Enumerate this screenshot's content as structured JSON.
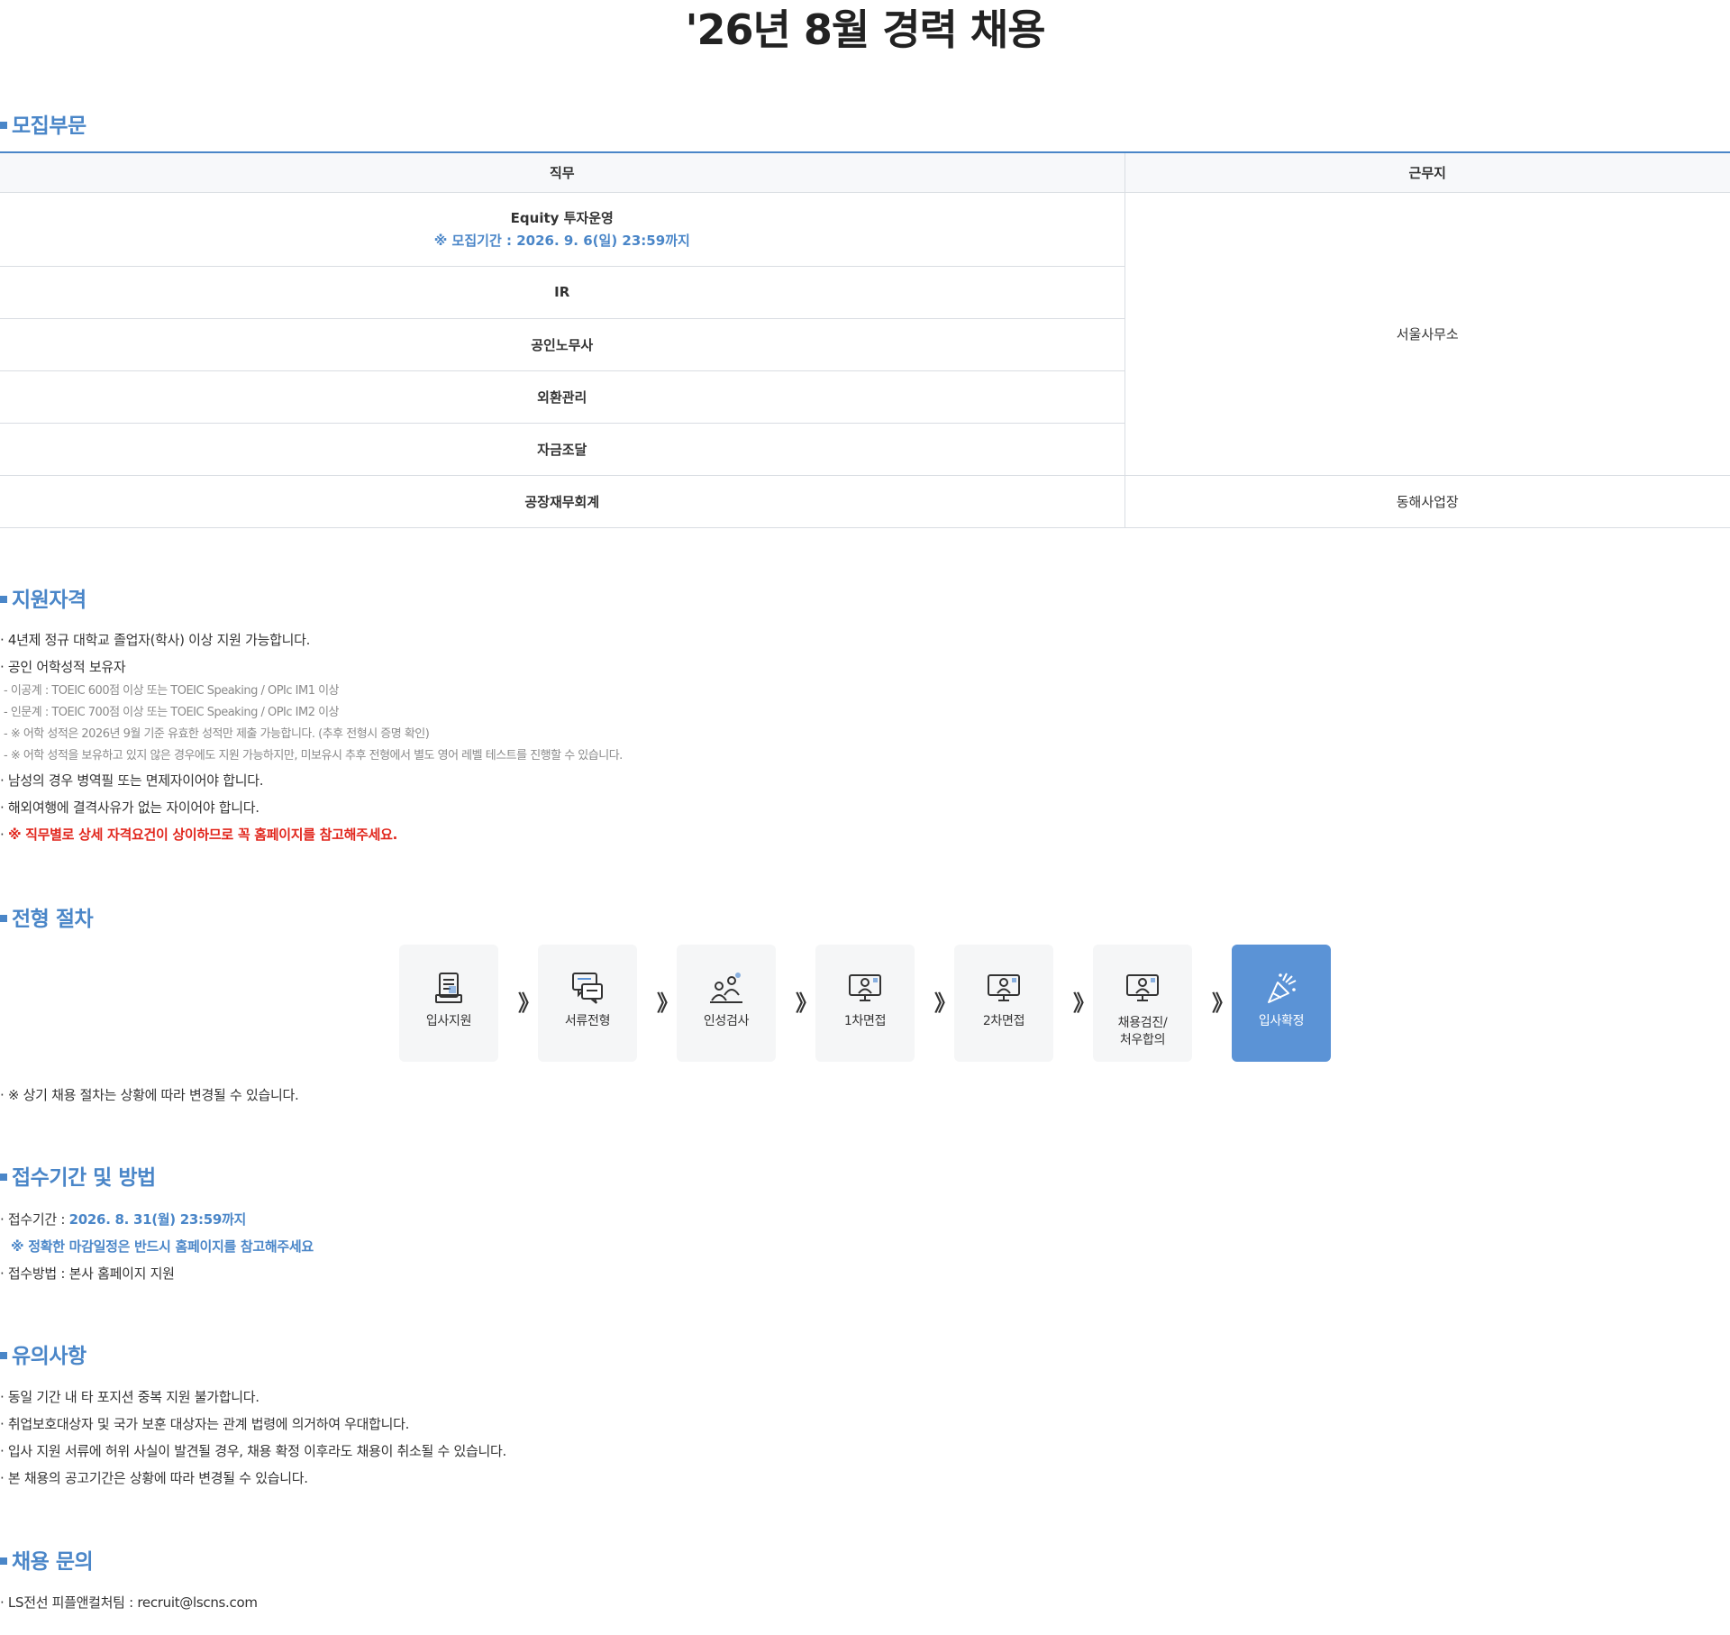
{
  "page": {
    "title": "'26년 8월 경력 채용"
  },
  "sections": {
    "recruit": "모집부문",
    "qualification": "지원자격",
    "process": "전형 절차",
    "application": "접수기간 및 방법",
    "notice": "유의사항",
    "inquiry": "채용 문의"
  },
  "table": {
    "headers": {
      "job": "직무",
      "location": "근무지"
    },
    "rows": [
      {
        "job": "Equity 투자운영",
        "note": "※ 모집기간 : 2026. 9. 6(일) 23:59까지"
      },
      {
        "job": "IR"
      },
      {
        "job": "공인노무사"
      },
      {
        "job": "외환관리"
      },
      {
        "job": "자금조달"
      },
      {
        "job": "공장재무회계"
      }
    ],
    "locations": {
      "seoul": "서울사무소",
      "donghae": "동해사업장"
    }
  },
  "qualification": {
    "items": [
      "· 4년제 정규 대학교 졸업자(학사) 이상 지원 가능합니다.",
      "· 공인 어학성적 보유자"
    ],
    "sub_items": [
      "- 이공계 : TOEIC 600점 이상 또는 TOEIC Speaking / OPIc IM1 이상",
      "- 인문계 : TOEIC 700점 이상 또는 TOEIC Speaking / OPIc IM2 이상",
      "- ※ 어학 성적은 2026년 9월 기준 유효한 성적만 제출 가능합니다. (추후 전형시 증명 확인)",
      "- ※ 어학 성적을 보유하고 있지 않은 경우에도 지원 가능하지만, 미보유시 추후 전형에서 별도 영어 레벨 테스트를 진행할 수 있습니다."
    ],
    "items2": [
      "· 남성의 경우 병역필 또는 면제자이어야 합니다.",
      "· 해외여행에 결격사유가 없는 자이어야 합니다."
    ],
    "warn_prefix": "· ",
    "warning": "※ 직무별로 상세 자격요건이 상이하므로 꼭 홈페이지를 참고해주세요."
  },
  "process": {
    "steps": [
      {
        "label": "입사지원",
        "icon": "document-icon"
      },
      {
        "label": "서류전형",
        "icon": "chat-icon"
      },
      {
        "label": "인성검사",
        "icon": "people-icon"
      },
      {
        "label": "1차면접",
        "icon": "monitor-person-icon"
      },
      {
        "label": "2차면접",
        "icon": "monitor-person-icon"
      },
      {
        "label": "채용검진/\n처우합의",
        "icon": "monitor-person-icon"
      },
      {
        "label": "입사확정",
        "icon": "party-popper-icon"
      }
    ],
    "arrow": "》",
    "note": "· ※ 상기 채용 절차는 상황에 따라 변경될 수 있습니다."
  },
  "application": {
    "period_label": "· 접수기간 : ",
    "period_value": "2026. 8. 31(월) 23:59까지",
    "period_note": "※ 정확한 마감일정은 반드시 홈페이지를 참고해주세요",
    "method": "· 접수방법 : 본사 홈페이지 지원"
  },
  "notice": {
    "items": [
      "· 동일 기간 내 타 포지션 중복 지원 불가합니다.",
      "· 취업보호대상자 및 국가 보훈 대상자는 관계 법령에 의거하여 우대합니다.",
      "· 입사 지원 서류에 허위 사실이 발견될 경우, 채용 확정 이후라도 채용이 취소될 수 있습니다.",
      "· 본 채용의 공고기간은 상황에 따라 변경될 수 있습니다."
    ]
  },
  "inquiry": {
    "contact": "· LS전선 피플앤컬처팀 : recruit@lscns.com"
  },
  "colors": {
    "accent": "#4a86c8",
    "warning": "#e1261c",
    "final_step": "#5b93d6"
  }
}
